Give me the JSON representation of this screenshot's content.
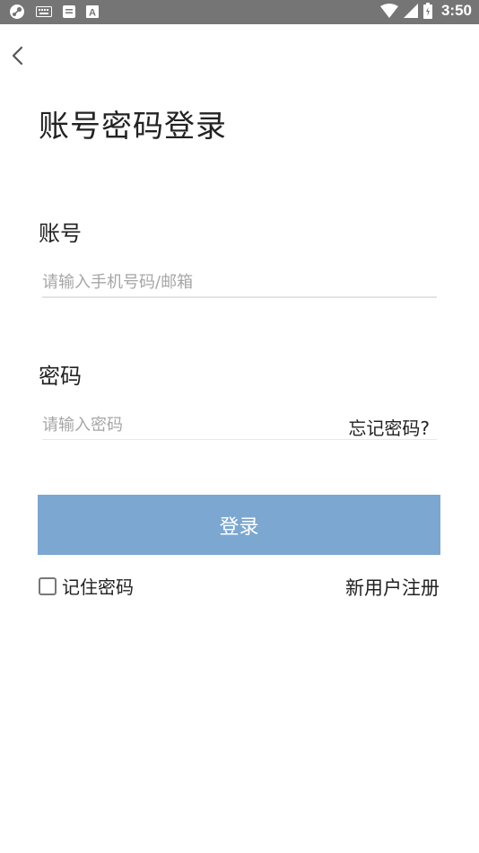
{
  "status_bar": {
    "time": "3:50",
    "icons": [
      "steam-icon",
      "keyboard-icon",
      "message-icon",
      "font-icon",
      "wifi-icon",
      "signal-icon",
      "battery-icon"
    ]
  },
  "header": {
    "back_icon": "chevron-left-icon",
    "title": "账号密码登录"
  },
  "account": {
    "label": "账号",
    "placeholder": "请输入手机号码/邮箱",
    "value": ""
  },
  "password": {
    "label": "密码",
    "placeholder": "请输入密码",
    "value": "",
    "forgot_label": "忘记密码?"
  },
  "login": {
    "button_label": "登录",
    "button_color": "#7ba7d0"
  },
  "remember": {
    "label": "记住密码",
    "checked": false
  },
  "register": {
    "label": "新用户注册"
  }
}
